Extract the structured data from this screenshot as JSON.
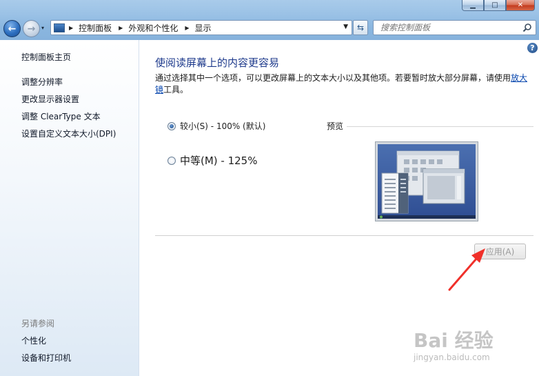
{
  "window": {
    "minimize_glyph": "▁",
    "maximize_glyph": "□",
    "close_glyph": "✕"
  },
  "nav": {
    "back_glyph": "←",
    "forward_glyph": "→",
    "history_glyph": "▾"
  },
  "address": {
    "icon": "control-panel-icon",
    "breadcrumbs": [
      "控制面板",
      "外观和个性化",
      "显示"
    ],
    "separator": "▶",
    "dropdown_glyph": "▼"
  },
  "refresh_glyph": "⇆",
  "search": {
    "placeholder": "搜索控制面板"
  },
  "sidebar": {
    "home_link": "控制面板主页",
    "links": [
      "调整分辨率",
      "更改显示器设置",
      "调整 ClearType 文本",
      "设置自定义文本大小(DPI)"
    ],
    "see_also_heading": "另请参阅",
    "see_also_links": [
      "个性化",
      "设备和打印机"
    ]
  },
  "main": {
    "help_glyph": "?",
    "title": "使阅读屏幕上的内容更容易",
    "description_before": "通过选择其中一个选项，可以更改屏幕上的文本大小以及其他项。若要暂时放大部分屏幕，请使用",
    "description_link": "放大镜",
    "description_after": "工具。",
    "options": [
      {
        "label": "较小(S) - 100% (默认)",
        "checked": true
      },
      {
        "label": "中等(M) - 125%",
        "checked": false
      }
    ],
    "preview_label": "预览",
    "apply_button": "应用(A)"
  },
  "annotation": {
    "color": "#f0302a"
  },
  "watermark": {
    "brand": "Bai 经验",
    "url": "jingyan.baidu.com"
  }
}
